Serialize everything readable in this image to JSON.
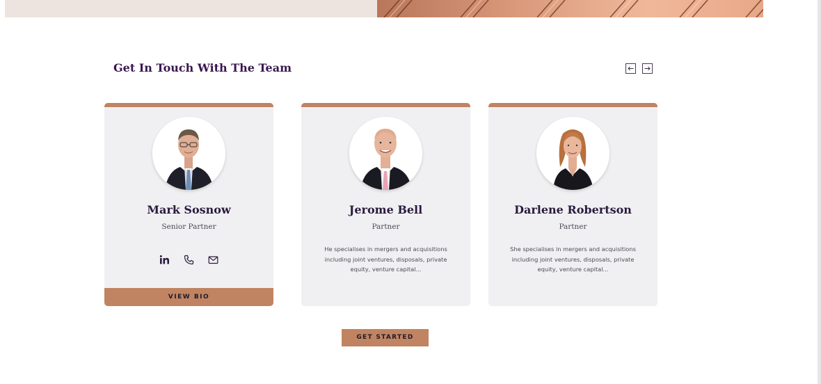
{
  "section": {
    "title": "Get In Touch With The Team",
    "prev_icon": "arrow-left-icon",
    "next_icon": "arrow-right-icon"
  },
  "team": [
    {
      "name": "Mark Sosnow",
      "role": "Senior Partner",
      "description": "",
      "contact_icons": [
        "linkedin-icon",
        "phone-icon",
        "mail-icon"
      ],
      "button_label": "VIEW BIO"
    },
    {
      "name": "Jerome Bell",
      "role": "Partner",
      "description": "He specialises in mergers and acquisitions including joint ventures, disposals, private equity, venture capital..."
    },
    {
      "name": "Darlene Robertson",
      "role": "Partner",
      "description": "She specialises in mergers and acquisitions including joint ventures, disposals, private equity, venture capital..."
    }
  ],
  "cta": {
    "label": "GET STARTED"
  },
  "colors": {
    "accent": "#c08462",
    "title": "#3a1650",
    "card_bg": "#f0f0f2",
    "hero_left": "#ede4df"
  }
}
